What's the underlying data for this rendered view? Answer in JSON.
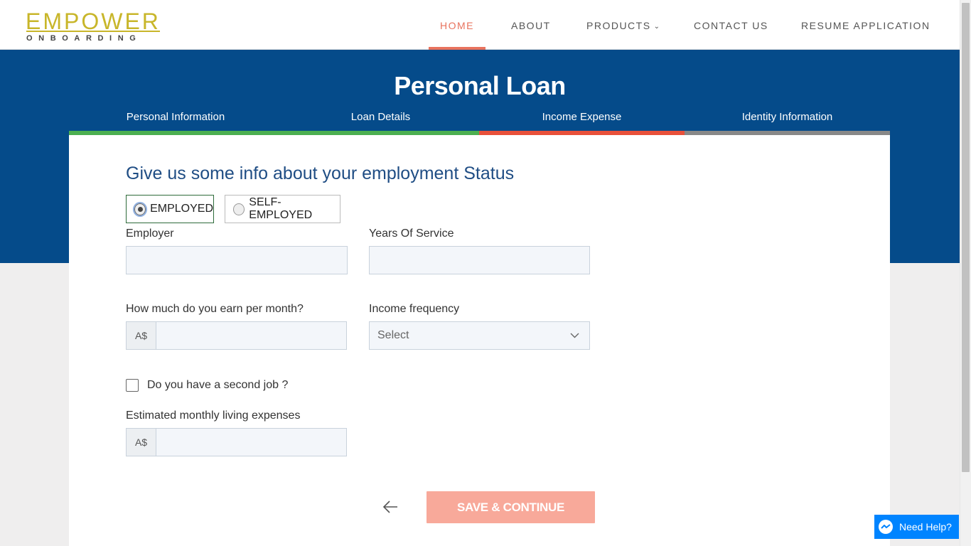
{
  "brand": {
    "name": "EMPOWER",
    "tagline": "ONBOARDING"
  },
  "nav": {
    "items": [
      {
        "label": "HOME",
        "active": true
      },
      {
        "label": "ABOUT"
      },
      {
        "label": "PRODUCTS",
        "has_dropdown": true
      },
      {
        "label": "CONTACT US"
      },
      {
        "label": "RESUME APPLICATION"
      }
    ]
  },
  "page": {
    "title": "Personal Loan"
  },
  "steps": [
    {
      "label": "Personal Information",
      "status": "complete"
    },
    {
      "label": "Loan Details",
      "status": "complete"
    },
    {
      "label": "Income Expense",
      "status": "current"
    },
    {
      "label": "Identity Information",
      "status": "pending"
    }
  ],
  "form": {
    "heading": "Give us some info about your employment Status",
    "employment_options": [
      {
        "label": "EMPLOYED",
        "selected": true
      },
      {
        "label": "SELF-EMPLOYED",
        "selected": false
      }
    ],
    "employer": {
      "label": "Employer",
      "value": ""
    },
    "years_of_service": {
      "label": "Years Of Service",
      "value": ""
    },
    "monthly_earnings": {
      "label": "How much do you earn per month?",
      "prefix": "A$",
      "value": ""
    },
    "income_frequency": {
      "label": "Income frequency",
      "selected": "Select"
    },
    "second_job": {
      "label": "Do you have a second job ?",
      "checked": false
    },
    "living_expenses": {
      "label": "Estimated monthly living expenses",
      "prefix": "A$",
      "value": ""
    },
    "save_button": "SAVE & CONTINUE"
  },
  "help": {
    "label": "Need Help?"
  },
  "colors": {
    "brand_gold": "#c8b62a",
    "nav_active": "#e8735e",
    "hero_blue": "#054b8a",
    "step_complete": "#4caf50",
    "step_current": "#e8503a",
    "step_pending": "#888888",
    "save_button": "#f8a99a",
    "help_blue": "#0084ff"
  }
}
